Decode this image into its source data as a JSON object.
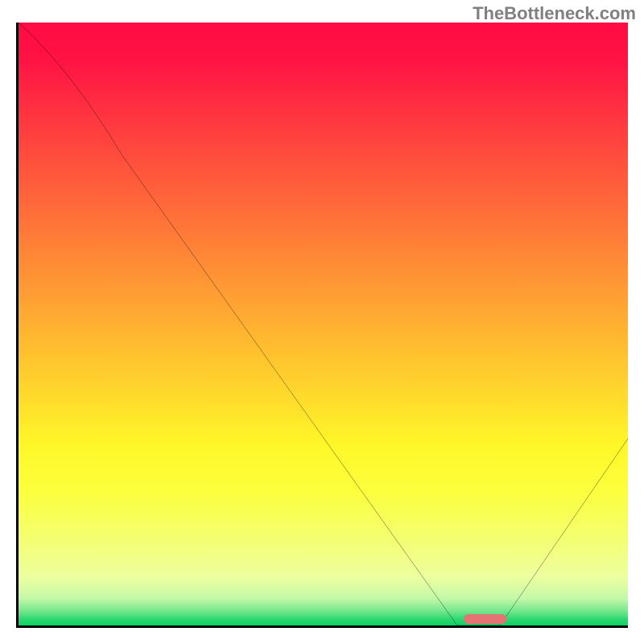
{
  "watermark": "TheBottleneck.com",
  "chart_data": {
    "type": "line",
    "title": "",
    "xlabel": "",
    "ylabel": "",
    "xlim": [
      0,
      100
    ],
    "ylim": [
      0,
      100
    ],
    "x": [
      0,
      17,
      72,
      79,
      100
    ],
    "series": [
      {
        "name": "curve",
        "values": [
          100,
          78,
          0,
          0,
          31
        ]
      }
    ],
    "gradient_stops": [
      {
        "pos": 0.0,
        "color": "#ff0b44"
      },
      {
        "pos": 0.06,
        "color": "#ff1244"
      },
      {
        "pos": 0.14,
        "color": "#ff2f41"
      },
      {
        "pos": 0.22,
        "color": "#ff4c3d"
      },
      {
        "pos": 0.3,
        "color": "#ff683a"
      },
      {
        "pos": 0.38,
        "color": "#ff8536"
      },
      {
        "pos": 0.46,
        "color": "#ffa133"
      },
      {
        "pos": 0.54,
        "color": "#ffbe2f"
      },
      {
        "pos": 0.62,
        "color": "#ffda2c"
      },
      {
        "pos": 0.7,
        "color": "#fff728"
      },
      {
        "pos": 0.78,
        "color": "#fcff3e"
      },
      {
        "pos": 0.86,
        "color": "#f3ff73"
      },
      {
        "pos": 0.92,
        "color": "#edffa0"
      },
      {
        "pos": 0.955,
        "color": "#c4f8a8"
      },
      {
        "pos": 0.975,
        "color": "#7ae88e"
      },
      {
        "pos": 0.99,
        "color": "#2bd870"
      },
      {
        "pos": 1.0,
        "color": "#0cd163"
      }
    ],
    "marker": {
      "x_start": 73,
      "x_end": 80,
      "color": "#e57373"
    }
  }
}
